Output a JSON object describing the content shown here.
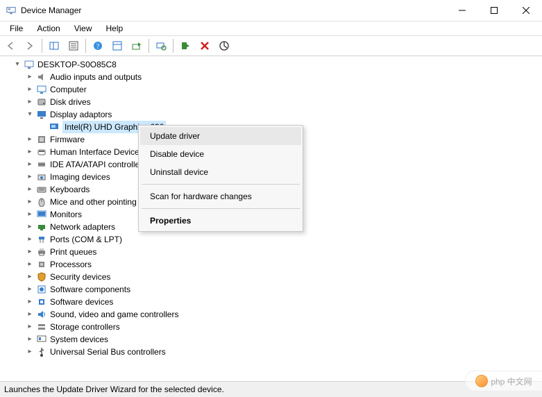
{
  "window": {
    "title": "Device Manager"
  },
  "menu": {
    "file": "File",
    "action": "Action",
    "view": "View",
    "help": "Help"
  },
  "tree": {
    "root": "DESKTOP-S0O85C8",
    "display_adaptors": "Display adaptors",
    "selected_device": "Intel(R) UHD Graphics 630",
    "categories": [
      "Audio inputs and outputs",
      "Computer",
      "Disk drives",
      "Firmware",
      "Human Interface Devices",
      "IDE ATA/ATAPI controllers",
      "Imaging devices",
      "Keyboards",
      "Mice and other pointing devices",
      "Monitors",
      "Network adapters",
      "Ports (COM & LPT)",
      "Print queues",
      "Processors",
      "Security devices",
      "Software components",
      "Software devices",
      "Sound, video and game controllers",
      "Storage controllers",
      "System devices",
      "Universal Serial Bus controllers"
    ]
  },
  "context_menu": {
    "update": "Update driver",
    "disable": "Disable device",
    "uninstall": "Uninstall device",
    "scan": "Scan for hardware changes",
    "properties": "Properties"
  },
  "statusbar": {
    "text": "Launches the Update Driver Wizard for the selected device."
  },
  "watermark": {
    "text": "php 中文网"
  }
}
